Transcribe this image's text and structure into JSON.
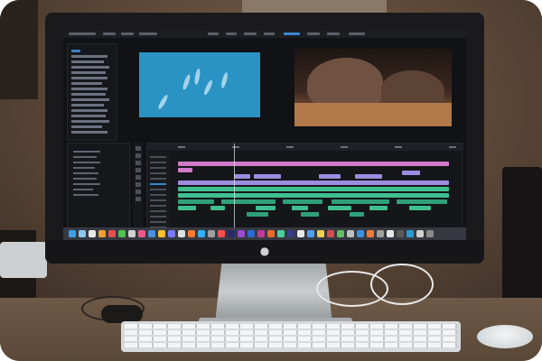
{
  "scene": {
    "subject": "desktop-monitor-video-editor",
    "colors": {
      "wall": "#5a4636",
      "desk": "#6e5947",
      "bezel": "#1a1a1c",
      "clip_video": "#d07ac8",
      "clip_purple": "#9d8ce0",
      "clip_audio": "#3fbf8f",
      "source_monitor": "#2b93c4"
    },
    "icons": [
      "apple-logo-icon",
      "dock-icon"
    ]
  }
}
